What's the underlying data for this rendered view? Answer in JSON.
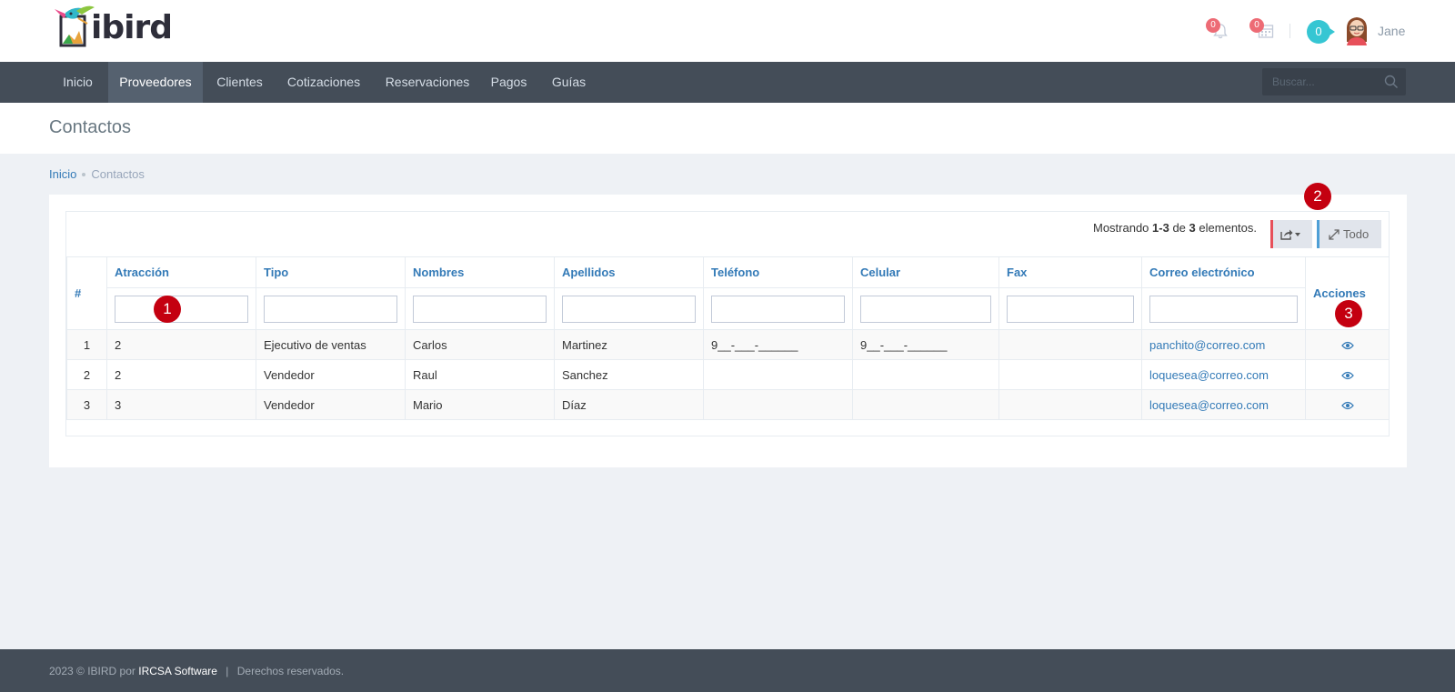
{
  "app": {
    "logo_text": "ibird",
    "colors": {
      "nav_bg": "#444d58",
      "nav_active": "#55616f",
      "link": "#337ab7",
      "badge": "#ed6b75",
      "counter": "#36c6d3",
      "marker": "#c40010"
    }
  },
  "header": {
    "notifications_count": "0",
    "calendar_count": "0",
    "counter": "0",
    "username": "Jane",
    "icons": {
      "notifications": "bell-icon",
      "calendar": "calendar-icon",
      "avatar": "avatar-icon"
    }
  },
  "nav": {
    "items": [
      {
        "label": "Inicio"
      },
      {
        "label": "Proveedores"
      },
      {
        "label": "Clientes"
      },
      {
        "label": "Cotizaciones"
      },
      {
        "label": "Reservaciones"
      },
      {
        "label": "Pagos"
      },
      {
        "label": "Guías"
      }
    ],
    "active": "Proveedores",
    "search_placeholder": "Buscar..."
  },
  "page": {
    "title": "Contactos",
    "breadcrumb": {
      "home": "Inicio",
      "current": "Contactos"
    }
  },
  "grid": {
    "summary_prefix": "Mostrando",
    "summary_range": "1-3",
    "summary_mid": "de",
    "summary_total": "3",
    "summary_suffix": "elementos.",
    "export_icon": "share-icon",
    "todo_label": "Todo",
    "columns": {
      "hash": "#",
      "atraccion": "Atracción",
      "tipo": "Tipo",
      "nombres": "Nombres",
      "apellidos": "Apellidos",
      "telefono": "Teléfono",
      "celular": "Celular",
      "fax": "Fax",
      "correo": "Correo electrónico",
      "acciones": "Acciones"
    },
    "rows": [
      {
        "n": "1",
        "atraccion": "2",
        "tipo": "Ejecutivo de ventas",
        "nombres": "Carlos",
        "apellidos": "Martinez",
        "telefono": "9__-___-______",
        "celular": "9__-___-______",
        "fax": "",
        "correo": "panchito@correo.com"
      },
      {
        "n": "2",
        "atraccion": "2",
        "tipo": "Vendedor",
        "nombres": "Raul",
        "apellidos": "Sanchez",
        "telefono": "",
        "celular": "",
        "fax": "",
        "correo": "loquesea@correo.com"
      },
      {
        "n": "3",
        "atraccion": "3",
        "tipo": "Vendedor",
        "nombres": "Mario",
        "apellidos": "Díaz",
        "telefono": "",
        "celular": "",
        "fax": "",
        "correo": "loquesea@correo.com"
      }
    ]
  },
  "markers": [
    "1",
    "2",
    "3"
  ],
  "footer": {
    "prefix": "2023 © IBIRD por",
    "brand": "IRCSA Software",
    "separator": "|",
    "rights": "Derechos reservados."
  }
}
